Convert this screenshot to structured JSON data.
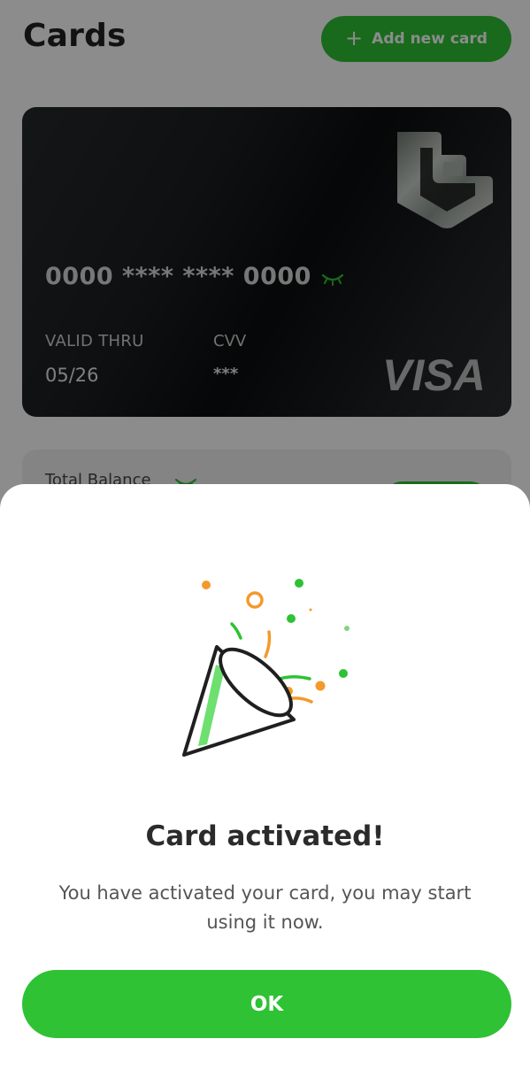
{
  "header": {
    "title": "Cards",
    "add_card_label": "Add new card"
  },
  "card": {
    "number": "0000 **** **** 0000",
    "valid_label": "VALID THRU",
    "valid_value": "05/26",
    "cvv_label": "CVV",
    "cvv_value": "***",
    "network": "VISA"
  },
  "balance": {
    "label": "Total Balance"
  },
  "dialog": {
    "title": "Card activated!",
    "message": "You have activated your card, you may start using it now.",
    "ok_label": "OK",
    "icon": "party-popper-icon"
  },
  "icons": {
    "plus": "plus-icon",
    "eye": "eye-closed-icon",
    "card_logo": "bank-logo-icon"
  },
  "colors": {
    "accent": "#2ec234",
    "card_bg": "#0b0d0e",
    "confetti_orange": "#f39a2b",
    "confetti_green": "#2ec234"
  }
}
